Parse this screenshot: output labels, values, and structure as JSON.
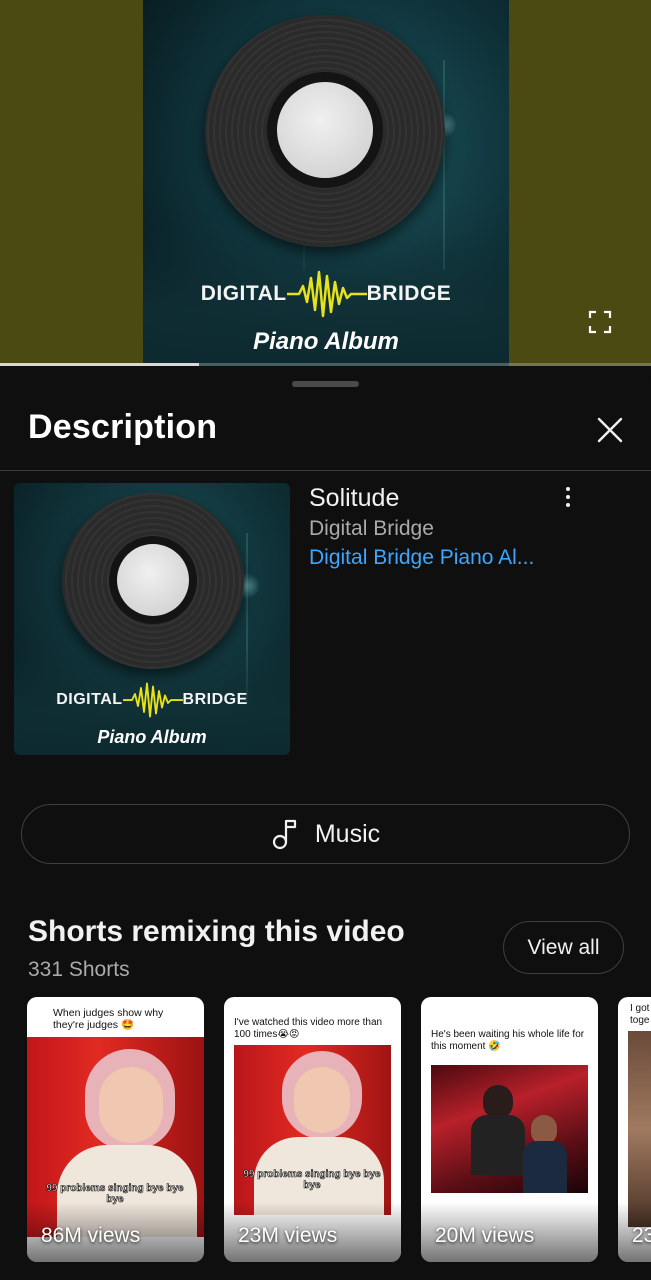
{
  "player": {
    "album_brand_left": "DIGITAL",
    "album_brand_right": "BRIDGE",
    "album_subtitle": "Piano Album",
    "progress_fraction": 0.305,
    "fullscreen_icon": "fullscreen-icon"
  },
  "sheet": {
    "title": "Description",
    "close_icon": "close-icon"
  },
  "track": {
    "title": "Solitude",
    "artist": "Digital Bridge",
    "album": "Digital Bridge Piano Al...",
    "thumb_brand_left": "DIGITAL",
    "thumb_brand_right": "BRIDGE",
    "thumb_subtitle": "Piano Album"
  },
  "music_button": {
    "label": "Music",
    "icon": "music-note-icon"
  },
  "shorts": {
    "heading": "Shorts remixing this video",
    "count": "331 Shorts",
    "view_all": "View all",
    "items": [
      {
        "caption": "When judges show why they're judges 🤩",
        "overlay": "99 problems singing bye bye bye",
        "views": "86M views"
      },
      {
        "caption": "I've watched this video more than 100 times😭😡",
        "overlay": "99 problems singing bye bye bye",
        "views": "23M views"
      },
      {
        "caption": "He's been waiting his whole life for this moment 🤣",
        "overlay": "",
        "views": "20M views"
      },
      {
        "caption": "I got toge",
        "overlay": "",
        "views": "23"
      }
    ]
  },
  "colors": {
    "background": "#0f0f0f",
    "link": "#3ea6ff",
    "player_side": "#4a4a12",
    "brand_wave": "#e8e21a"
  }
}
